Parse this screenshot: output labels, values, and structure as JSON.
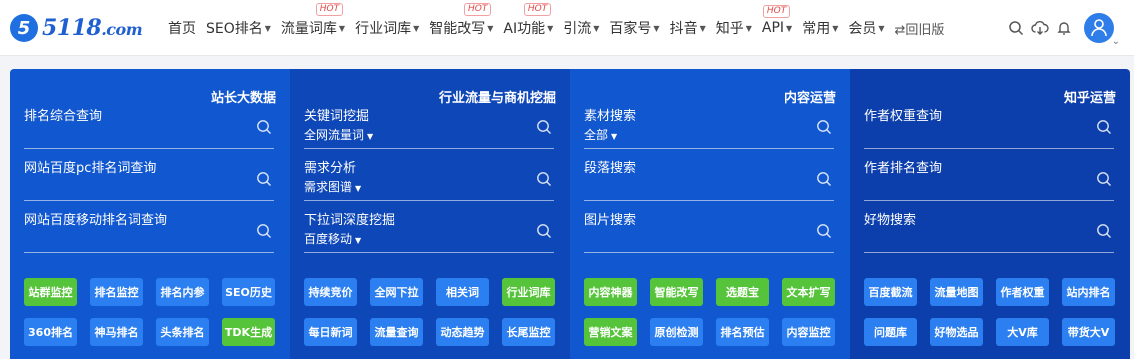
{
  "header": {
    "logo_mark": "5",
    "logo_text": "5118",
    "logo_domain": ".com",
    "nav": [
      {
        "label": "首页",
        "caret": false,
        "hot": false
      },
      {
        "label": "SEO排名",
        "caret": true,
        "hot": false
      },
      {
        "label": "流量词库",
        "caret": true,
        "hot": true
      },
      {
        "label": "行业词库",
        "caret": true,
        "hot": false
      },
      {
        "label": "智能改写",
        "caret": true,
        "hot": true
      },
      {
        "label": "AI功能",
        "caret": true,
        "hot": true
      },
      {
        "label": "引流",
        "caret": true,
        "hot": false
      },
      {
        "label": "百家号",
        "caret": true,
        "hot": false
      },
      {
        "label": "抖音",
        "caret": true,
        "hot": false
      },
      {
        "label": "知乎",
        "caret": true,
        "hot": false
      },
      {
        "label": "API",
        "caret": true,
        "hot": true
      },
      {
        "label": "常用",
        "caret": true,
        "hot": false
      },
      {
        "label": "会员",
        "caret": true,
        "hot": false
      }
    ],
    "hot_badge": "HOT",
    "old_version": "⇄回旧版",
    "icons": [
      "search-icon",
      "cloud-download-icon",
      "bell-icon",
      "avatar-icon"
    ]
  },
  "panel": {
    "columns": [
      {
        "title": "站长大数据",
        "rows": [
          {
            "label": "排名综合查询",
            "sub": ""
          },
          {
            "label": "网站百度pc排名词查询",
            "sub": ""
          },
          {
            "label": "网站百度移动排名词查询",
            "sub": ""
          }
        ],
        "buttons": [
          {
            "label": "站群监控",
            "color": "green"
          },
          {
            "label": "排名监控",
            "color": "blue"
          },
          {
            "label": "排名内参",
            "color": "blue"
          },
          {
            "label": "SEO历史",
            "color": "blue"
          },
          {
            "label": "360排名",
            "color": "blue"
          },
          {
            "label": "神马排名",
            "color": "blue"
          },
          {
            "label": "头条排名",
            "color": "blue"
          },
          {
            "label": "TDK生成",
            "color": "green"
          }
        ]
      },
      {
        "title": "行业流量与商机挖掘",
        "rows": [
          {
            "label": "关键词挖掘",
            "sub": "全网流量词"
          },
          {
            "label": "需求分析",
            "sub": "需求图谱"
          },
          {
            "label": "下拉词深度挖掘",
            "sub": "百度移动"
          }
        ],
        "buttons": [
          {
            "label": "持续竞价",
            "color": "blue"
          },
          {
            "label": "全网下拉",
            "color": "blue"
          },
          {
            "label": "相关词",
            "color": "blue"
          },
          {
            "label": "行业词库",
            "color": "green"
          },
          {
            "label": "每日新词",
            "color": "blue"
          },
          {
            "label": "流量查询",
            "color": "blue"
          },
          {
            "label": "动态趋势",
            "color": "blue"
          },
          {
            "label": "长尾监控",
            "color": "blue"
          }
        ]
      },
      {
        "title": "内容运营",
        "rows": [
          {
            "label": "素材搜索",
            "sub": "全部"
          },
          {
            "label": "段落搜索",
            "sub": ""
          },
          {
            "label": "图片搜索",
            "sub": ""
          }
        ],
        "buttons": [
          {
            "label": "内容神器",
            "color": "green"
          },
          {
            "label": "智能改写",
            "color": "green"
          },
          {
            "label": "选题宝",
            "color": "green"
          },
          {
            "label": "文本扩写",
            "color": "green"
          },
          {
            "label": "营销文案",
            "color": "green"
          },
          {
            "label": "原创检测",
            "color": "blue"
          },
          {
            "label": "排名预估",
            "color": "blue"
          },
          {
            "label": "内容监控",
            "color": "blue"
          }
        ]
      },
      {
        "title": "知乎运营",
        "rows": [
          {
            "label": "作者权重查询",
            "sub": ""
          },
          {
            "label": "作者排名查询",
            "sub": ""
          },
          {
            "label": "好物搜索",
            "sub": ""
          }
        ],
        "buttons": [
          {
            "label": "百度截流",
            "color": "blue"
          },
          {
            "label": "流量地图",
            "color": "blue"
          },
          {
            "label": "作者权重",
            "color": "blue"
          },
          {
            "label": "站内排名",
            "color": "blue"
          },
          {
            "label": "问题库",
            "color": "blue"
          },
          {
            "label": "好物选品",
            "color": "blue"
          },
          {
            "label": "大V库",
            "color": "blue"
          },
          {
            "label": "带货大V",
            "color": "blue"
          }
        ]
      }
    ]
  }
}
